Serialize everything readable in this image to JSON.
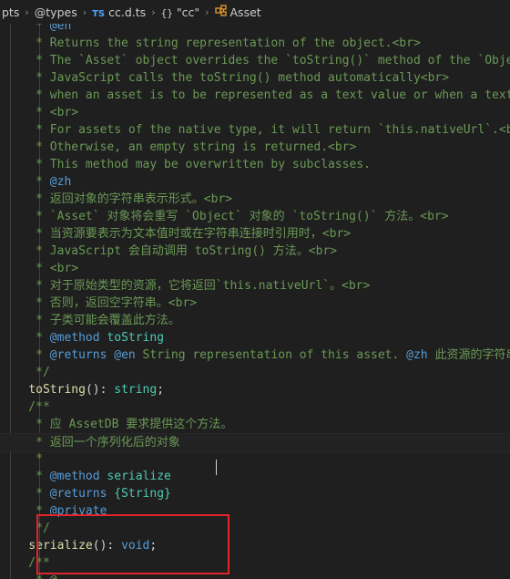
{
  "breadcrumb": {
    "segments": [
      "pts",
      "@types",
      "cc.d.ts",
      "\"cc\"",
      "Asset"
    ],
    "file_badge": "TS",
    "object_glyph": "{}"
  },
  "code": {
    "lines": [
      "     * @en",
      "     * Returns the string representation of the object.<br>",
      "     * The `Asset` object overrides the `toString()` method of the `Object`",
      "     * JavaScript calls the toString() method automatically<br>",
      "     * when an asset is to be represented as a text value or when a texture",
      "     * <br>",
      "     * For assets of the native type, it will return `this.nativeUrl`.<br>",
      "     * Otherwise, an empty string is returned.<br>",
      "     * This method may be overwritten by subclasses.",
      "     * @zh",
      "     * 返回对象的字符串表示形式。<br>",
      "     * `Asset` 对象将会重写 `Object` 对象的 `toString()` 方法。<br>",
      "     * 当资源要表示为文本值时或在字符串连接时引用时，<br>",
      "     * JavaScript 会自动调用 toString() 方法。<br>",
      "     * <br>",
      "     * 对于原始类型的资源，它将返回`this.nativeUrl`。<br>",
      "     * 否则，返回空字符串。<br>",
      "     * 子类可能会覆盖此方法。",
      "     * @method toString",
      "     * @returns @en String representation of this asset. @zh 此资源的字符串表示。",
      "     */",
      "    toString(): string;",
      "    /**",
      "     * 应 AssetDB 要求提供这个方法。",
      "     * 返回一个序列化后的对象",
      "     *",
      "     * @method serialize",
      "     * @returns {String}",
      "     * @private",
      "     */",
      "    serialize(): void;",
      "    /**",
      "     * @"
    ]
  },
  "colors": {
    "background": "#1f1f1f",
    "comment": "#6a9955",
    "function": "#dcdcaa",
    "type": "#4ec9b0",
    "keyword": "#569cd6",
    "highlight_box": "#e3242b"
  }
}
